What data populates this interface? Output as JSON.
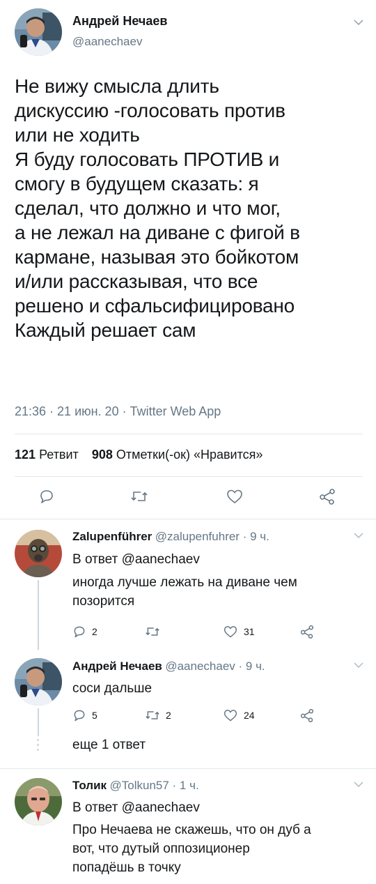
{
  "tweet": {
    "author_name": "Андрей Нечаев",
    "author_handle": "@aanechaev",
    "text_lines": [
      "Не вижу смысла длить",
      "дискуссию -голосовать против",
      "или не ходить",
      "Я буду голосовать ПРОТИВ и",
      "смогу в будущем сказать: я",
      "сделал, что должно и что мог,",
      "а не лежал на диване с фигой в",
      "кармане, называя это бойкотом",
      "и/или рассказывая, что все",
      "решено и сфальсифицировано",
      "Каждый решает сам"
    ],
    "meta": "21:36 · 21 июн. 20 · Twitter Web App",
    "retweets_count": "121",
    "retweets_label": "Ретвит",
    "likes_count": "908",
    "likes_label": "Отметки(-ок) «Нравится»"
  },
  "replies": [
    {
      "name": "Zalupenführer",
      "handle_time": "@zalupenfuhrer · 9 ч.",
      "reply_to": "В ответ @aanechaev",
      "text_lines": [
        "иногда лучше лежать на диване чем",
        "позорится"
      ],
      "reply_count": "2",
      "retweet_count": "",
      "like_count": "31"
    },
    {
      "name": "Андрей Нечаев",
      "handle_time": "@aanechaev · 9 ч.",
      "text_lines": [
        "соси дальше"
      ],
      "reply_count": "5",
      "retweet_count": "2",
      "like_count": "24"
    },
    {
      "name": "Толик",
      "handle_time": "@Tolkun57 · 1 ч.",
      "reply_to": "В ответ @aanechaev",
      "text_lines": [
        "Про Нечаева не скажешь, что он дуб а",
        "вот, что дутый оппозиционер",
        "попадёшь в точку"
      ]
    }
  ],
  "more_replies": "еще 1 ответ",
  "colors": {
    "text": "#14171a",
    "secondary": "#657786",
    "divider": "#e1e8ed",
    "thread_line": "#ccd6dd"
  },
  "icons": [
    "chevron-down-icon",
    "reply-icon",
    "retweet-icon",
    "like-icon",
    "share-icon"
  ]
}
